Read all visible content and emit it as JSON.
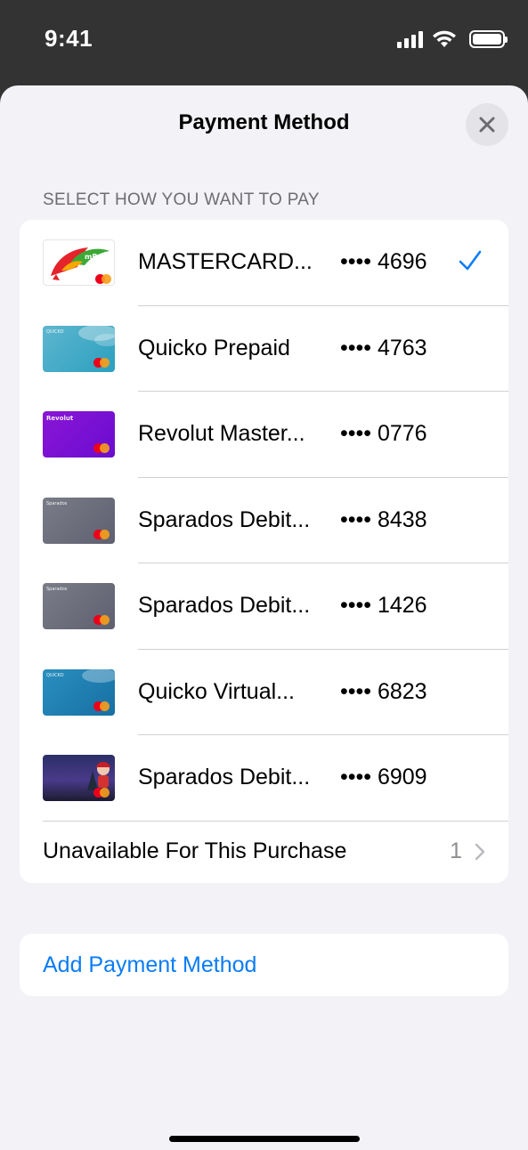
{
  "status_bar": {
    "time": "9:41"
  },
  "sheet": {
    "title": "Payment Method",
    "section_header": "SELECT HOW YOU WANT TO PAY",
    "cards": [
      {
        "name": "MASTERCARD...",
        "digits": "•••• 4696",
        "selected": true,
        "art": "mbank",
        "art_text": "mBank"
      },
      {
        "name": "Quicko Prepaid",
        "digits": "•••• 4763",
        "selected": false,
        "art": "quicko",
        "art_text": "QUICKO"
      },
      {
        "name": "Revolut Master...",
        "digits": "•••• 0776",
        "selected": false,
        "art": "revolut",
        "art_text": "Revolut"
      },
      {
        "name": "Sparados Debit...",
        "digits": "•••• 8438",
        "selected": false,
        "art": "sparados",
        "art_text": "Sparados"
      },
      {
        "name": "Sparados Debit...",
        "digits": "•••• 1426",
        "selected": false,
        "art": "sparados",
        "art_text": "Sparados"
      },
      {
        "name": "Quicko Virtual...",
        "digits": "•••• 6823",
        "selected": false,
        "art": "quicko-dark",
        "art_text": "QUICKO"
      },
      {
        "name": "Sparados Debit...",
        "digits": "•••• 6909",
        "selected": false,
        "art": "sparados-photo",
        "art_text": ""
      }
    ],
    "unavailable": {
      "label": "Unavailable For This Purchase",
      "count": "1"
    },
    "add_payment_label": "Add Payment Method"
  },
  "colors": {
    "accent": "#0a7cf5",
    "sheet_bg": "#f2f2f7",
    "status_bar_bg": "#333333"
  }
}
